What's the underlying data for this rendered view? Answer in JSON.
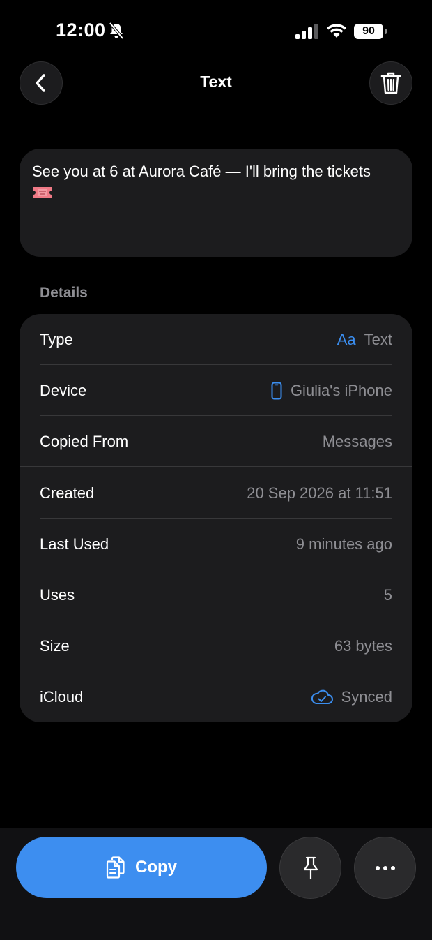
{
  "status_bar": {
    "time": "12:00",
    "battery": "90"
  },
  "nav": {
    "title": "Text"
  },
  "content": {
    "text": "See you at 6 at Aurora Café — I'll bring the tickets"
  },
  "details": {
    "header": "Details",
    "rows": [
      {
        "label": "Type",
        "value": "Text",
        "icon": "Aa"
      },
      {
        "label": "Device",
        "value": "Giulia's iPhone"
      },
      {
        "label": "Copied From",
        "value": "Messages"
      },
      {
        "label": "Created",
        "value": "20 Sep 2026 at 11:51"
      },
      {
        "label": "Last Used",
        "value": "9 minutes ago"
      },
      {
        "label": "Uses",
        "value": "5"
      },
      {
        "label": "Size",
        "value": "63 bytes"
      },
      {
        "label": "iCloud",
        "value": "Synced"
      }
    ]
  },
  "actions": {
    "copy_label": "Copy"
  },
  "colors": {
    "accent": "#3d8ef0",
    "card": "#1c1c1e",
    "secondary_text": "#8e8e93"
  }
}
